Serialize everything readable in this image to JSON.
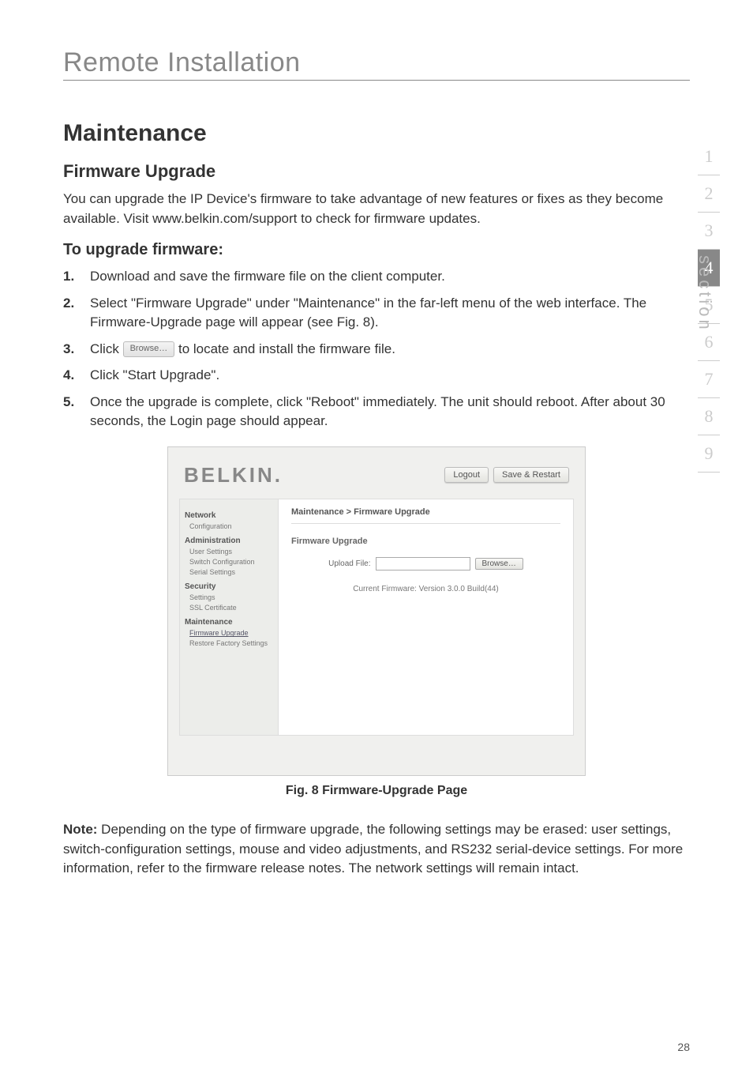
{
  "page_title": "Remote Installation",
  "heading_maintenance": "Maintenance",
  "heading_firmware_upgrade": "Firmware Upgrade",
  "intro_text": "You can upgrade the IP Device's firmware to take advantage of new features or fixes as they become available. Visit www.belkin.com/support to check for firmware updates.",
  "heading_to_upgrade": "To upgrade firmware:",
  "steps": {
    "s1": "Download and save the firmware file on the client computer.",
    "s2": "Select \"Firmware Upgrade\" under \"Maintenance\" in the far-left menu of the web interface. The Firmware-Upgrade page will appear (see Fig. 8).",
    "s3_a": "Click ",
    "s3_b": " to locate and install the firmware file.",
    "s3_btn": "Browse…",
    "s4": "Click \"Start Upgrade\".",
    "s5": "Once the upgrade is complete, click \"Reboot\" immediately. The unit should reboot. After about 30 seconds, the Login page should appear."
  },
  "screenshot": {
    "logo": "BELKIN.",
    "btn_logout": "Logout",
    "btn_save_restart": "Save & Restart",
    "sidebar": {
      "network_head": "Network",
      "network_items": [
        "Configuration"
      ],
      "admin_head": "Administration",
      "admin_items": [
        "User Settings",
        "Switch Configuration",
        "Serial Settings"
      ],
      "security_head": "Security",
      "security_items": [
        "Settings",
        "SSL Certificate"
      ],
      "maint_head": "Maintenance",
      "maint_items": [
        "Firmware Upgrade",
        "Restore Factory Settings"
      ]
    },
    "breadcrumb": "Maintenance > Firmware Upgrade",
    "section_title": "Firmware Upgrade",
    "upload_label": "Upload File:",
    "browse_btn": "Browse…",
    "version_text": "Current Firmware: Version 3.0.0 Build(44)"
  },
  "fig_caption": "Fig. 8 Firmware-Upgrade Page",
  "note_label": "Note:",
  "note_body": " Depending on the type of firmware upgrade, the following settings may be erased: user settings, switch-configuration settings, mouse and video adjustments, and RS232 serial-device settings. For more information, refer to the firmware release notes. The network settings will remain intact.",
  "tabs": [
    "1",
    "2",
    "3",
    "4",
    "5",
    "6",
    "7",
    "8",
    "9"
  ],
  "tab_label": "section",
  "page_number": "28"
}
